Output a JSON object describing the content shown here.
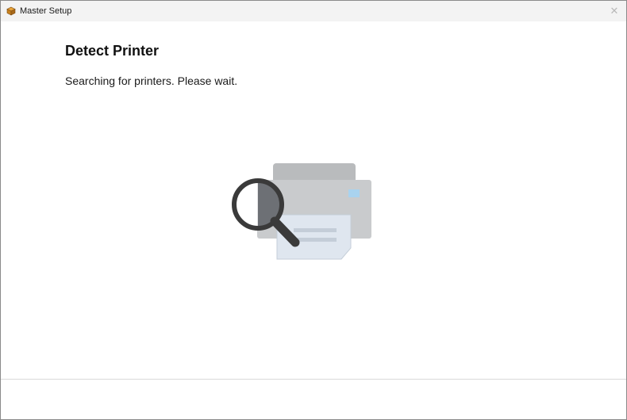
{
  "window": {
    "title": "Master Setup",
    "app_icon": "package-box-icon",
    "close_icon": "close-icon",
    "close_glyph": "✕"
  },
  "page": {
    "heading": "Detect Printer",
    "message": "Searching for printers. Please wait.",
    "illustration": "printer-search-icon"
  },
  "colors": {
    "title_bar": "#f3f3f3",
    "printer_body": "#c9cbcd",
    "printer_top": "#b9bbbd",
    "paper": "#dfe6ef",
    "printer_indicator": "#a9d3ef",
    "magnifier": "#3a3a3a"
  }
}
